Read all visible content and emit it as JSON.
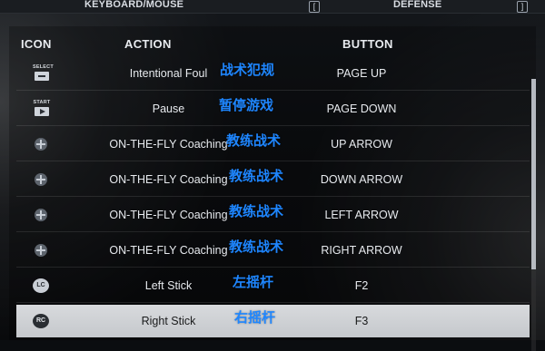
{
  "topbar": {
    "left_tab": "KEYBOARD/MOUSE",
    "right_tab": "DEFENSE",
    "left_btn_glyph": "[",
    "right_btn_glyph": "]"
  },
  "columns": {
    "icon": "ICON",
    "action": "ACTION",
    "button": "BUTTON"
  },
  "rows": [
    {
      "icon": "select-key",
      "icon_label": "SELECT",
      "action": "Intentional Foul",
      "button": "PAGE UP",
      "cn": "战术犯规"
    },
    {
      "icon": "start-key",
      "icon_label": "START",
      "action": "Pause",
      "button": "PAGE DOWN",
      "cn": "暂停游戏"
    },
    {
      "icon": "dpad-icon",
      "icon_label": "",
      "action": "ON-THE-FLY Coaching",
      "button": "UP ARROW",
      "cn": "教练战术"
    },
    {
      "icon": "dpad-icon",
      "icon_label": "",
      "action": "ON-THE-FLY Coaching",
      "button": "DOWN ARROW",
      "cn": "教练战术"
    },
    {
      "icon": "dpad-icon",
      "icon_label": "",
      "action": "ON-THE-FLY Coaching",
      "button": "LEFT ARROW",
      "cn": "教练战术"
    },
    {
      "icon": "dpad-icon",
      "icon_label": "",
      "action": "ON-THE-FLY Coaching",
      "button": "RIGHT ARROW",
      "cn": "教练战术"
    },
    {
      "icon": "left-stick-icon",
      "icon_label": "LC",
      "action": "Left Stick",
      "button": "F2",
      "cn": "左摇杆"
    },
    {
      "icon": "right-stick-icon",
      "icon_label": "RC",
      "action": "Right Stick",
      "button": "F3",
      "cn": "右摇杆",
      "selected": true
    }
  ]
}
